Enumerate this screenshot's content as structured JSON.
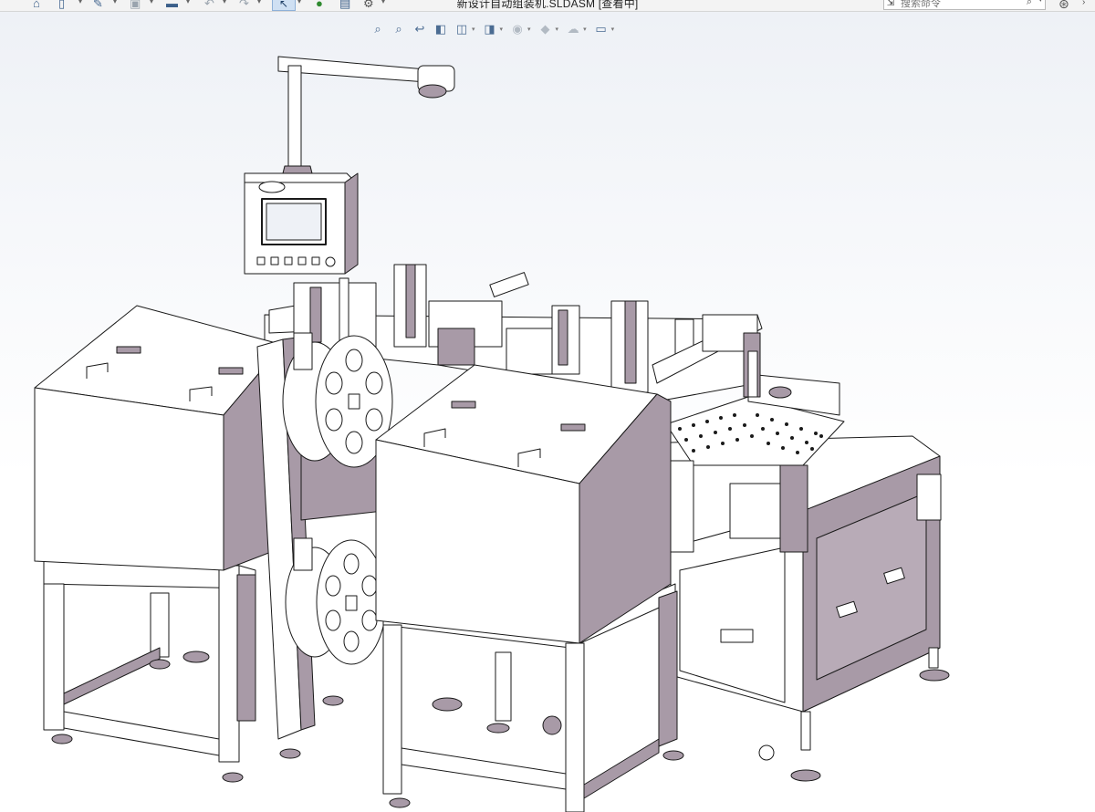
{
  "window": {
    "title": "新设计自动组装机.SLDASM [查看中]"
  },
  "search": {
    "placeholder": "搜索命令"
  },
  "toolbar": {
    "icons": [
      "home-icon",
      "new-document-icon",
      "open-folder-icon",
      "save-icon",
      "print-icon",
      "undo-icon",
      "redo-icon",
      "select-pointer-icon",
      "traffic-light-icon",
      "file-properties-icon",
      "options-gear-icon"
    ]
  },
  "heads_up_toolbar": {
    "icons": [
      "zoom-to-fit-icon",
      "zoom-to-area-icon",
      "previous-view-icon",
      "section-view-icon",
      "view-orientation-icon",
      "display-style-icon",
      "hide-show-items-icon",
      "edit-appearance-icon",
      "apply-scene-icon",
      "view-settings-icon"
    ]
  },
  "colors": {
    "model_fill": "#a89aa7",
    "model_light": "#ffffff",
    "model_edge": "#1a1a1a",
    "selection_highlight": "#cfe0f3"
  }
}
